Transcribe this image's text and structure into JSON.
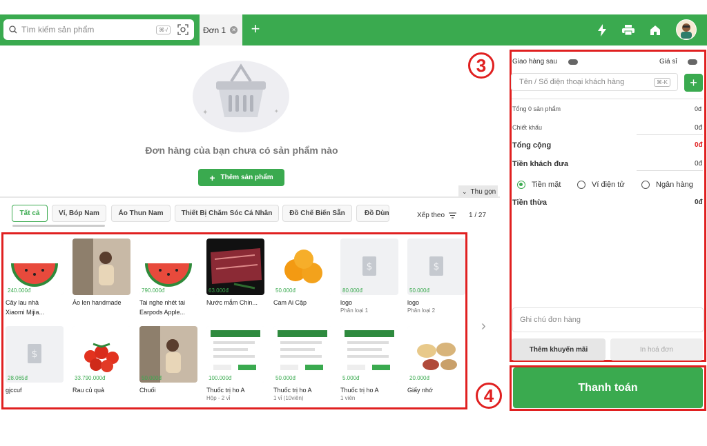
{
  "topbar": {
    "search_placeholder": "Tìm kiếm sản phẩm",
    "search_shortcut": "⌘-/",
    "order_tab": "Đơn 1",
    "accent": "#3aaa4f"
  },
  "cart": {
    "empty_message": "Đơn hàng của bạn chưa có sản phẩm nào",
    "add_product_label": "Thêm sản phẩm",
    "collapse_label": "Thu gọn"
  },
  "categories": [
    "Tất cả",
    "Ví, Bóp Nam",
    "Áo Thun Nam",
    "Thiết Bị Chăm Sóc Cá Nhân",
    "Đồ Chế Biến Sẵn",
    "Đồ Dùng"
  ],
  "sort_label": "Xếp theo",
  "pagination": "1 / 27",
  "products": [
    {
      "price": "240.000đ",
      "name1": "Cây lau nhà",
      "name2": "Xiaomi Mijia...",
      "img": "watermelon"
    },
    {
      "price": "",
      "name1": "Áo len handmade",
      "name2": "",
      "img": "photo"
    },
    {
      "price": "790.000đ",
      "name1": "Tai nghe nhét tai",
      "name2": "Earpods Apple...",
      "img": "watermelon"
    },
    {
      "price": "63.000đ",
      "name1": "Nước mắm Chin...",
      "name2": "",
      "img": "meat"
    },
    {
      "price": "50.000đ",
      "name1": "Cam Ai Cập",
      "name2": "",
      "img": "orange"
    },
    {
      "price": "80.000đ",
      "name1": "logo",
      "name2": "Phân loại 1",
      "img": "placeholder"
    },
    {
      "price": "50.000đ",
      "name1": "logo",
      "name2": "Phân loại 2",
      "img": "placeholder"
    },
    {
      "price": "28.065đ",
      "name1": "gjccuf",
      "name2": "",
      "img": "placeholder"
    },
    {
      "price": "33.790.000đ",
      "name1": "Rau củ quả",
      "name2": "",
      "img": "tomato"
    },
    {
      "price": "50.000đ",
      "name1": "Chuối",
      "name2": "",
      "img": "photo"
    },
    {
      "price": "100.000đ",
      "name1": "Thuốc trị ho A",
      "name2": "Hộp - 2 vỉ",
      "img": "screenshot"
    },
    {
      "price": "50.000đ",
      "name1": "Thuốc trị ho A",
      "name2": "1 vỉ (10viên)",
      "img": "screenshot"
    },
    {
      "price": "5.000đ",
      "name1": "Thuốc trị ho A",
      "name2": "1 viên",
      "img": "screenshot"
    },
    {
      "price": "20.000đ",
      "name1": "Giấy nhớ",
      "name2": "",
      "img": "beans"
    }
  ],
  "checkout": {
    "deliver_later": "Giao hàng sau",
    "wholesale": "Giá sỉ",
    "customer_placeholder": "Tên / Số điện thoại khách hàng",
    "customer_shortcut": "⌘-K",
    "total_items_label": "Tổng 0 sản phẩm",
    "total_items_value": "0đ",
    "discount_label": "Chiết khấu",
    "discount_value": "0đ",
    "grand_total_label": "Tổng cộng",
    "grand_total_value": "0đ",
    "customer_paid_label": "Tiền khách đưa",
    "customer_paid_value": "0đ",
    "methods": [
      "Tiền mặt",
      "Ví điện tử",
      "Ngân hàng"
    ],
    "change_label": "Tiền thừa",
    "change_value": "0đ",
    "note_placeholder": "Ghi chú đơn hàng",
    "promo_label": "Thêm khuyến mãi",
    "print_label": "In hoá đơn",
    "pay_label": "Thanh toán"
  },
  "markers": [
    "3",
    "4"
  ]
}
